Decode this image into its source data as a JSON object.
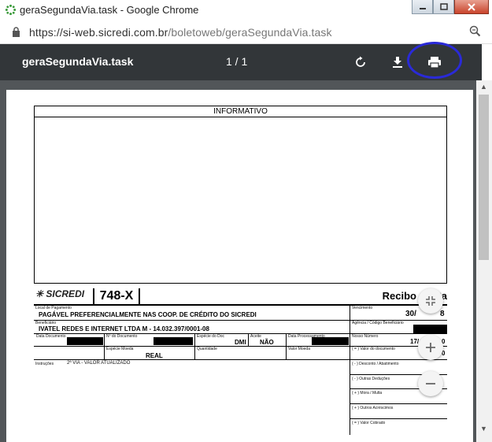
{
  "window": {
    "title": "geraSegundaVia.task - Google Chrome",
    "url_host": "https://si-web.sicredi.com.br",
    "url_path": "/boletoweb/geraSegundaVia.task"
  },
  "pdf_toolbar": {
    "title": "geraSegundaVia.task",
    "page_count": "1 / 1"
  },
  "document": {
    "info_header": "INFORMATIVO",
    "bank_logo": "SICREDI",
    "bank_code": "748-X",
    "recibo": "Recibo do Pa",
    "local_pagamento_label": "Local de Pagamento",
    "local_pagamento": "PAGÁVEL PREFERENCIALMENTE NAS COOP. DE CRÉDITO DO SICREDI",
    "vencimento_label": "Vencimento",
    "vencimento": "30/",
    "vencimento_tail": "8",
    "beneficiario_label": "Beneficiário",
    "beneficiario": "IVATEL REDES E INTERNET LTDA M - 14.032.397/0001-08",
    "agencia_label": "Agência / Código Beneficiário",
    "data_documento_label": "Data Documento",
    "nr_documento_label": "Nº do Documento",
    "especie_doc_label": "Espécie do Doc",
    "especie_doc": "DMI",
    "aceite_label": "Aceite",
    "aceite": "NÃO",
    "data_processamento_label": "Data Processamento",
    "nosso_numero_label": "Nosso Número",
    "nosso_numero": "17/",
    "nosso_numero_tail": "0",
    "especie_moeda_label": "Espécie Moeda",
    "especie_moeda": "REAL",
    "quantidade_label": "Quantidade",
    "valor_moeda_label": "Valor Moeda",
    "valor_documento_label": "( = ) Valor do documento",
    "valor_tail": "0",
    "instrucoes_label": "Instruções",
    "instrucoes": "2ª VIA - VALOR ATUALIZADO",
    "desconto_label": "( - ) Desconto / Abatimento",
    "outras_deducoes_label": "( - ) Outras Deduções",
    "mora_label": "( + ) Mora / Multa",
    "acrescimos_label": "( + ) Outros Acréscimos",
    "valor_cobrado_label": "( = ) Valor Cobrado"
  },
  "icons": {
    "rotate": "rotate-icon",
    "download": "download-icon",
    "print": "print-icon",
    "fit": "fit-page-icon",
    "zoom_in": "zoom-in-icon",
    "zoom_out": "zoom-out-icon"
  },
  "colors": {
    "toolbar": "#323639",
    "viewer": "#525659",
    "highlight": "#2a2ad8"
  }
}
